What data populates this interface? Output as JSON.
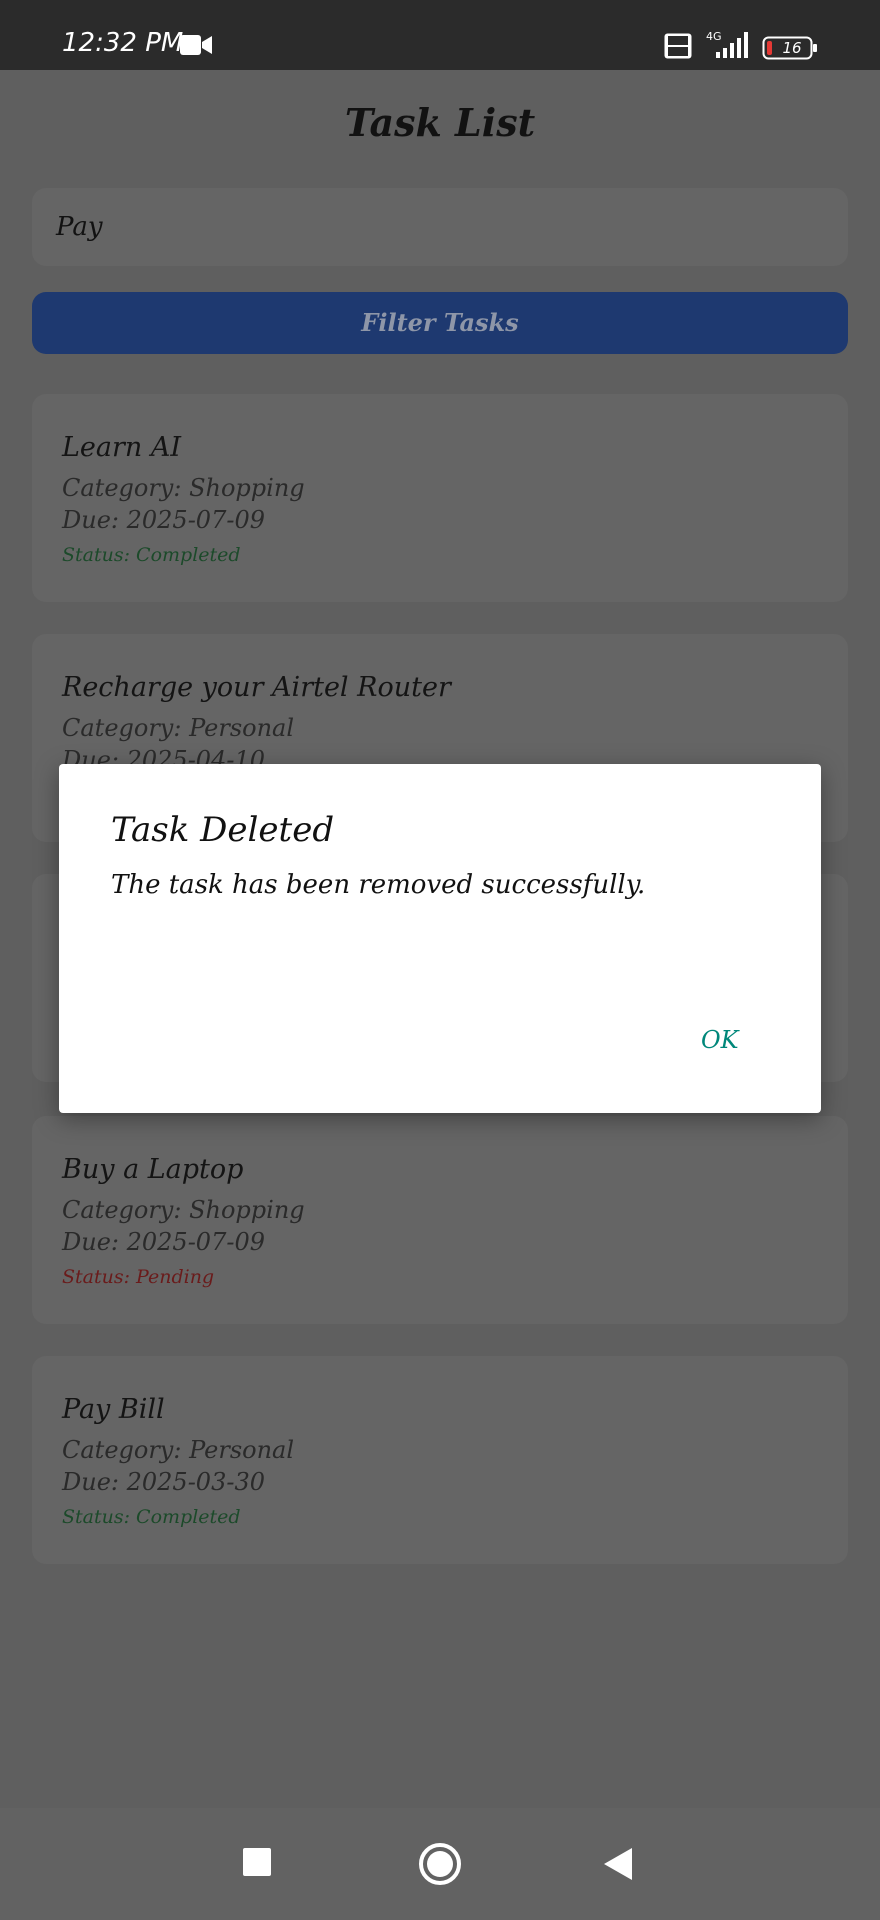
{
  "status_bar": {
    "time": "12:32 PM",
    "network": "4G",
    "battery": "16",
    "icons": [
      "video-camera-icon",
      "volte-icon",
      "signal-icon",
      "battery-icon"
    ]
  },
  "page": {
    "title": "Task List"
  },
  "filter": {
    "input_value": "Pay",
    "button_label": "Filter Tasks"
  },
  "tasks": [
    {
      "title": "Learn AI",
      "category": "Category: Shopping",
      "due": "Due: 2025-07-09",
      "status": "Status: Completed"
    },
    {
      "title": "Recharge your Airtel Router",
      "category": "Category: Personal",
      "due": "Due: 2025-04-10",
      "status": ""
    },
    {
      "title": "",
      "category": "",
      "due": "",
      "status": ""
    },
    {
      "title": "Buy a Laptop",
      "category": "Category: Shopping",
      "due": "Due: 2025-07-09",
      "status": "Status: Pending"
    },
    {
      "title": "Pay Bill",
      "category": "Category: Personal",
      "due": "Due: 2025-03-30",
      "status": "Status: Completed"
    }
  ],
  "dialog": {
    "title": "Task Deleted",
    "message": "The task has been removed successfully.",
    "ok_label": "OK"
  },
  "colors": {
    "accent_button": "#1e3970",
    "dialog_action": "#00877a",
    "status_completed": "#1c4a2a",
    "status_pending": "#6a1b1b"
  },
  "nav": {
    "icons": [
      "recents-icon",
      "home-icon",
      "back-icon"
    ]
  }
}
